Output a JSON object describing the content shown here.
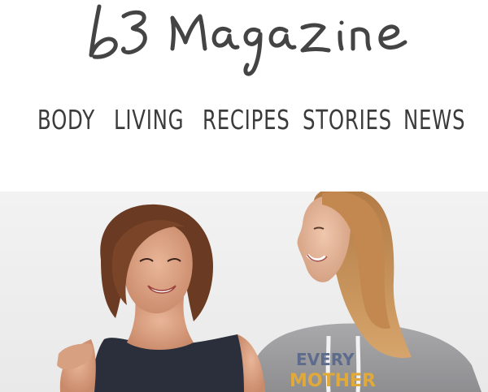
{
  "brand": {
    "logo_text": "b3 Magazine"
  },
  "nav": {
    "items": [
      {
        "label": "BODY"
      },
      {
        "label": "LIVING"
      },
      {
        "label": "RECIPES"
      },
      {
        "label": "STORIES"
      },
      {
        "label": "NEWS"
      }
    ]
  },
  "hero": {
    "shirt_text_line1": "EVERY",
    "shirt_text_line2": "MOTHER"
  },
  "colors": {
    "nav_text": "#3b3b3b",
    "logo_ink": "#444444",
    "hero_background": "#efefef",
    "shirt_accent": "#e0a93a"
  }
}
